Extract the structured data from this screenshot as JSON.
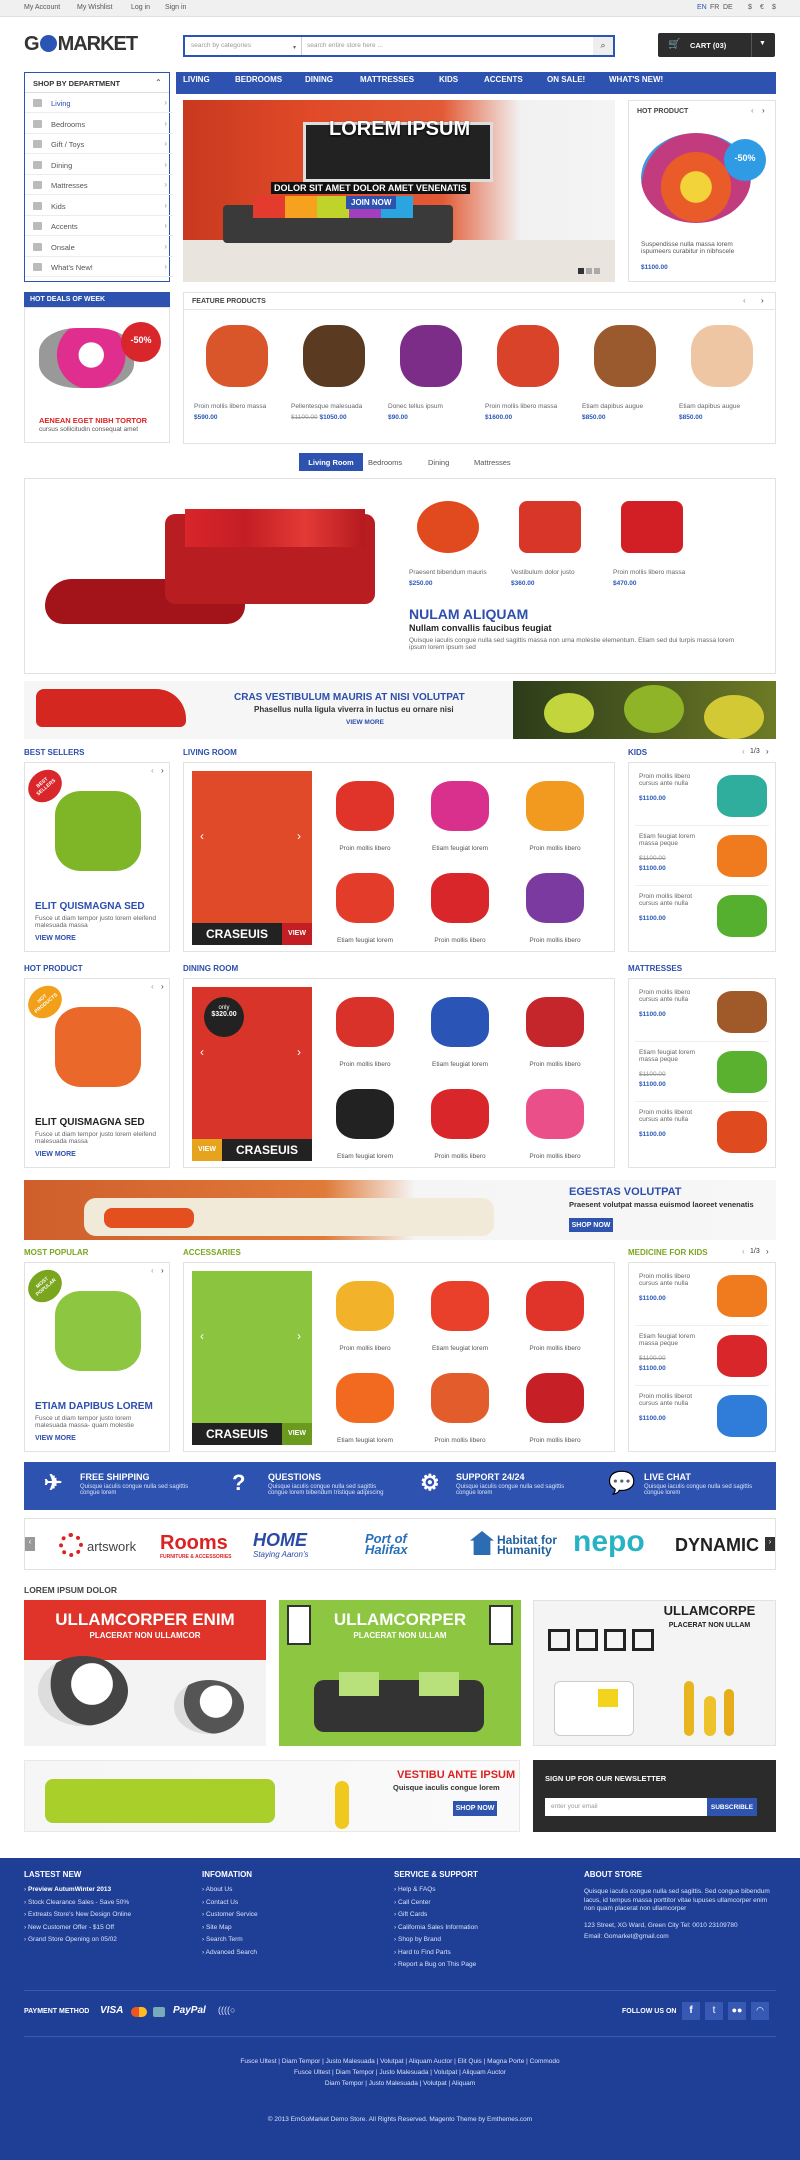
{
  "topbar": {
    "links": [
      "My Account",
      "My Wishlist",
      "Log in",
      "Sign in"
    ],
    "langs": [
      "EN",
      "FR",
      "DE"
    ],
    "currency": [
      "$",
      "€",
      "$"
    ]
  },
  "header": {
    "logo_a": "G",
    "logo_b": "MARKET",
    "search_category": "search by categories",
    "search_placeholder": "search entire store here ...",
    "cart": "CART (03)"
  },
  "sidebar": {
    "title": "SHOP BY DEPARTMENT",
    "items": [
      "Living",
      "Bedrooms",
      "Gift / Toys",
      "Dining",
      "Mattresses",
      "Kids",
      "Accents",
      "Onsale",
      "What's New!"
    ]
  },
  "menu": [
    "LIVING",
    "BEDROOMS",
    "DINING",
    "MATTRESSES",
    "KIDS",
    "ACCENTS",
    "ON SALE!",
    "WHAT'S NEW!"
  ],
  "hero": {
    "title": "LOREM IPSUM",
    "subtitle": "DOLOR SIT AMET DOLOR AMET VENENATIS",
    "cta": "JOIN NOW"
  },
  "hot_product": {
    "title": "HOT PRODUCT",
    "badge": "-50%",
    "desc": "Suspendisse nulla massa lorem ispumeers curabitur in nibhscele",
    "price": "$1100.00"
  },
  "hot_deals": {
    "title": "HOT DEALS OF WEEK",
    "badge": "-50%",
    "name": "AENEAN EGET NIBH TORTOR",
    "desc": "cursus sollicitudin consequat amet"
  },
  "featured": {
    "title": "FEATURE PRODUCTS",
    "items": [
      {
        "name": "Proin mollis libero massa",
        "price": "$590.00",
        "old": ""
      },
      {
        "name": "Pellentesque malesuada",
        "price": "$1050.00",
        "old": "$1100.00"
      },
      {
        "name": "Donec tellus ipsum",
        "price": "$90.00",
        "old": ""
      },
      {
        "name": "Proin mollis libero massa",
        "price": "$1600.00",
        "old": ""
      },
      {
        "name": "Etiam dapibus augue",
        "price": "$850.00",
        "old": ""
      },
      {
        "name": "Etiam dapibus augue",
        "price": "$850.00",
        "old": ""
      }
    ]
  },
  "tabs": [
    "Living Room",
    "Bedrooms",
    "Dining",
    "Mattresses"
  ],
  "living_showcase": {
    "items": [
      {
        "name": "Praesent bibendum mauris",
        "price": "$250.00"
      },
      {
        "name": "Vestibulum dolor justo",
        "price": "$360.00"
      },
      {
        "name": "Proin mollis libero massa",
        "price": "$470.00"
      }
    ],
    "title": "NULAM ALIQUAM",
    "subtitle": "Nullam convallis faucibus feugiat",
    "desc": "Quisque iaculis congue nulla sed sagittis massa non urna molestie elementum. Etiam sed dui turpis massa lorem ipsum lorem ipsum sed"
  },
  "banner1": {
    "title": "CRAS VESTIBULUM MAURIS AT NISI VOLUTPAT",
    "subtitle": "Phasellus nulla ligula viverra in luctus eu ornare nisi",
    "cta": "VIEW MORE"
  },
  "row1": {
    "best": "BEST SELLERS",
    "living": "LIVING ROOM",
    "kids": "KIDS",
    "pager": "1/3",
    "bs_badge": "BEST SELLERS",
    "bs_name": "ELIT QUISMAGNA SED",
    "bs_desc": "Fusce ut diam tempor justo lorem eleifend malesuada massa",
    "bs_more": "VIEW MORE",
    "cat_label": "CRASEUIS",
    "view": "VIEW",
    "grid": [
      "Proin mollis libero",
      "Etiam feugiat lorem",
      "Proin mollis libero",
      "Etiam feugiat lorem",
      "Proin mollis libero",
      "Proin mollis libero"
    ],
    "side": [
      {
        "name": "Proin mollis libero cursus ante nulla",
        "price": "$1100.00",
        "old": ""
      },
      {
        "name": "Etiam feugiat lorem massa peque",
        "price": "$1100.00",
        "old": "$1100.00"
      },
      {
        "name": "Proin mollis liberot cursus ante nulla",
        "price": "$1100.00",
        "old": ""
      }
    ]
  },
  "row2": {
    "hot": "HOT PRODUCT",
    "dining": "DINING ROOM",
    "mattresses": "MATTRESSES",
    "hp_badge": "HOT PRODUCTS",
    "hp_name": "ELIT QUISMAGNA SED",
    "hp_desc": "Fusce ut diam tempor justo lorem eleifend malesuada massa",
    "hp_more": "VIEW MORE",
    "only": "only",
    "only_price": "$320.00",
    "cat_label": "CRASEUIS",
    "view": "VIEW",
    "grid": [
      "Proin mollis libero",
      "Etiam feugiat lorem",
      "Proin mollis libero",
      "Etiam feugiat lorem",
      "Proin mollis libero",
      "Proin mollis libero"
    ],
    "side": [
      {
        "name": "Proin mollis libero cursus ante nulla",
        "price": "$1100.00",
        "old": ""
      },
      {
        "name": "Etiam feugiat lorem massa peque",
        "price": "$1100.00",
        "old": "$1100.00"
      },
      {
        "name": "Proin mollis liberot cursus ante nulla",
        "price": "$1100.00",
        "old": ""
      }
    ]
  },
  "banner2": {
    "title": "EGESTAS VOLUTPAT",
    "subtitle": "Praesent volutpat massa euismod laoreet venenatis",
    "cta": "SHOP NOW"
  },
  "row3": {
    "popular": "MOST POPULAR",
    "accessaries": "ACCESSARIES",
    "medicine": "MEDICINE FOR KIDS",
    "pager": "1/3",
    "mp_badge": "MOST POPULAR",
    "mp_name": "ETIAM DAPIBUS LOREM",
    "mp_desc": "Fusce ut diam tempor justo lorem malesuada massa- quam molestie",
    "mp_more": "VIEW MORE",
    "cat_label": "CRASEUIS",
    "view": "VIEW",
    "grid": [
      "Proin mollis libero",
      "Etiam feugiat lorem",
      "Proin mollis libero",
      "Etiam feugiat lorem",
      "Proin mollis libero",
      "Proin mollis libero"
    ],
    "side": [
      {
        "name": "Proin mollis libero cursus ante nulla",
        "price": "$1100.00",
        "old": ""
      },
      {
        "name": "Etiam feugiat lorem massa peque",
        "price": "$1100.00",
        "old": "$1100.00"
      },
      {
        "name": "Proin mollis liberot cursus ante nulla",
        "price": "$1100.00",
        "old": ""
      }
    ]
  },
  "services": [
    {
      "title": "FREE SHIPPING",
      "desc": "Quisque iaculis congue nulla sed sagittis congue lorem"
    },
    {
      "title": "QUESTIONS",
      "desc": "Quisque iaculis congue nulla sed sagittis congue lorem bibendum tristique adipiscing"
    },
    {
      "title": "SUPPORT 24/24",
      "desc": "Quisque iaculis congue nulla sed sagittis congue lorem"
    },
    {
      "title": "LIVE CHAT",
      "desc": "Quisque iaculis congue nulla sed sagittis congue lorem"
    }
  ],
  "brands": [
    "artswork",
    "Rooms",
    "HOME",
    "Port of Halifax",
    "Habitat for Humanity",
    "nepo",
    "DYNAMIC"
  ],
  "brand_sub": {
    "rooms": "FURNITURE & ACCESSORIES",
    "home": "Staying Aaron's"
  },
  "promo": {
    "title": "LOREM IPSUM DOLOR",
    "cards": [
      {
        "title": "ULLAMCORPER ENIM",
        "sub": "PLACERAT NON ULLAMCOR"
      },
      {
        "title": "ULLAMCORPER",
        "sub": "PLACERAT NON ULLAM"
      },
      {
        "title": "ULLAMCORPE",
        "sub": "PLACERAT NON ULLAM"
      }
    ]
  },
  "banner3": {
    "title": "VESTIBU ANTE IPSUM",
    "subtitle": "Quisque iaculis congue lorem",
    "cta": "SHOP NOW"
  },
  "newsletter": {
    "title": "SIGN UP FOR OUR NEWSLETTER",
    "placeholder": "enter your email",
    "cta": "SUBSCRIBLE"
  },
  "footer": {
    "cols": [
      {
        "title": "LASTEST NEW",
        "items": [
          "Preview AutumWinter 2013",
          "Stock Clearance Sales - Save 50%",
          "Extreats Store's New Design Online",
          "New Customer Offer - $15 Off",
          "Grand Store Opening on 05/02"
        ]
      },
      {
        "title": "INFOMATION",
        "items": [
          "About Us",
          "Contact Us",
          "Customer Service",
          "Site Map",
          "Search Term",
          "Advanced Search"
        ]
      },
      {
        "title": "SERVICE & SUPPORT",
        "items": [
          "Help & FAQs",
          "Call Center",
          "Gift Cards",
          "California Sales Information",
          "Shop by Brand",
          "Hard to Find Parts",
          "Report a Bug on This Page"
        ]
      }
    ],
    "about_title": "ABOUT STORE",
    "about": "Quisque iaculis congue nulla sed sagittis. Sed congue bibendum lacus, id tempus massa porttitor vitae lupuses ullamcorper enim non quam placerat non ullamcorper",
    "address": "123 Street, XG Ward, Green City Tel: 0010 23109780",
    "email": "Email: Gomarket@gmail.com",
    "payment": "PAYMENT METHOD",
    "follow": "FOLLOW US ON",
    "links1": [
      "Fusce Ultest",
      "Diam Tempor",
      "Justo Malesuada",
      "Volutpat",
      "Aliquam Auctor",
      "Elit Quis",
      "Magna Porte",
      "Commodo"
    ],
    "links2": [
      "Fusce Ultest",
      "Diam Tempor",
      "Justo Malesuada",
      "Volutpat",
      "Aliquam Auctor"
    ],
    "links3": [
      "Diam Tempor",
      "Justo Malesuada",
      "Volutpat",
      "Aliquam"
    ],
    "copyright": "© 2013 EmGoMarket Demo Store. All Rights Reserved. Magento Theme by Emthemes.com"
  },
  "colors": {
    "brand_blue": "#2d52b0",
    "accent_red": "#d9262b",
    "green": "#7aa61f",
    "footer_bg": "#1e3f96"
  }
}
